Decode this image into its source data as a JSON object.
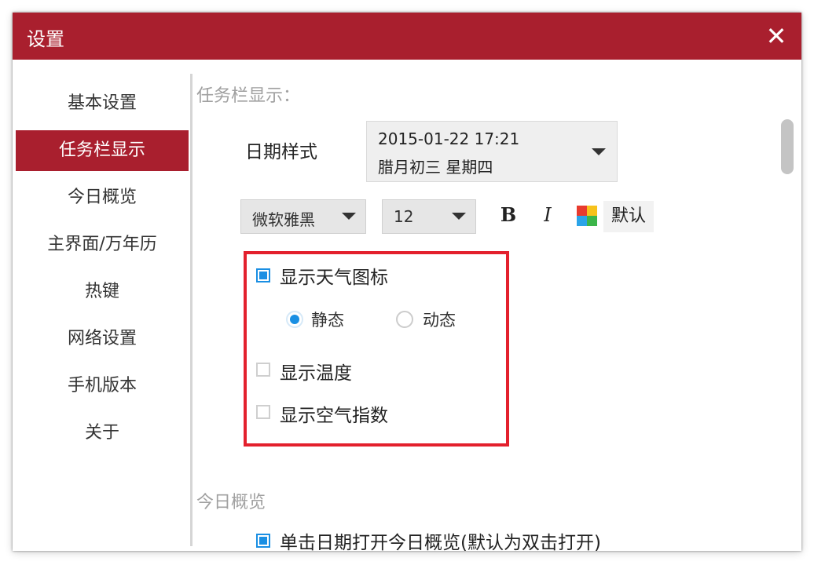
{
  "window": {
    "title": "设置",
    "close_glyph": "✕"
  },
  "sidebar": {
    "items": [
      {
        "label": "基本设置"
      },
      {
        "label": "任务栏显示",
        "active": true
      },
      {
        "label": "今日概览"
      },
      {
        "label": "主界面/万年历"
      },
      {
        "label": "热键"
      },
      {
        "label": "网络设置"
      },
      {
        "label": "手机版本"
      },
      {
        "label": "关于"
      }
    ]
  },
  "taskbar_section": {
    "title": "任务栏显示：",
    "date_style_label": "日期样式",
    "date_style_value_line1": "2015-01-22 17:21",
    "date_style_value_line2": "腊月初三 星期四",
    "font_family_value": "微软雅黑",
    "font_size_value": "12",
    "bold_label": "B",
    "italic_label": "I",
    "color_icon": "color-palette-icon",
    "default_label": "默认",
    "show_weather_icon": {
      "label": "显示天气图标",
      "checked": true
    },
    "weather_mode": {
      "options": [
        {
          "label": "静态",
          "selected": true
        },
        {
          "label": "动态",
          "selected": false
        }
      ]
    },
    "show_temperature": {
      "label": "显示温度",
      "checked": false
    },
    "show_air_index": {
      "label": "显示空气指数",
      "checked": false
    }
  },
  "overview_section": {
    "title": "今日概览",
    "click_open_option": {
      "label": "单击日期打开今日概览(默认为双击打开)",
      "checked": true
    }
  },
  "colors": {
    "accent": "#a91f2e",
    "highlight_border": "#e3202d",
    "checkbox_blue": "#1a8fe3",
    "palette": [
      "#e83b2e",
      "#f7c21b",
      "#2aa4e8",
      "#3cb54a"
    ]
  }
}
